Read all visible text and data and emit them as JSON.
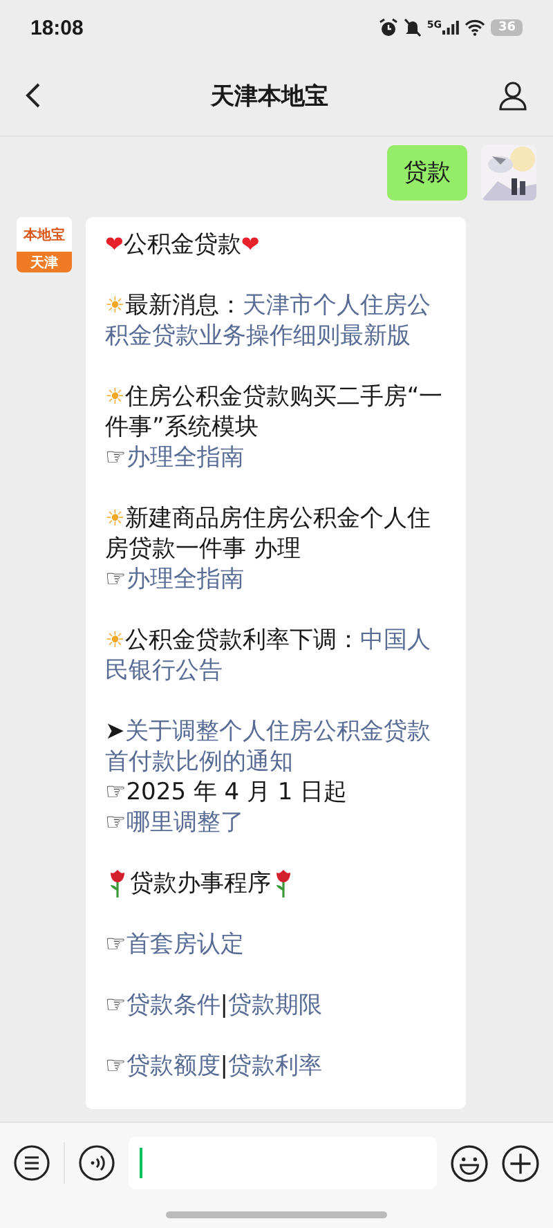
{
  "status_bar": {
    "time": "18:08",
    "network": "5G",
    "battery": "36"
  },
  "header": {
    "title": "天津本地宝"
  },
  "messages": [
    {
      "kind": "sent",
      "text": "贷款"
    },
    {
      "kind": "received",
      "avatar_top": "本地宝",
      "avatar_bottom": "天津",
      "paragraphs": [
        [
          [
            {
              "kind": "emoji",
              "text": "❤",
              "color": "#e8202a"
            },
            {
              "kind": "text",
              "text": "公积金贷款"
            },
            {
              "kind": "emoji",
              "text": "❤",
              "color": "#e8202a"
            }
          ]
        ],
        [
          [
            {
              "kind": "emoji",
              "text": "☀",
              "color": "#f5a623"
            },
            {
              "kind": "text",
              "text": "最新消息："
            },
            {
              "kind": "link",
              "text": "天津市个人住房公"
            }
          ],
          [
            {
              "kind": "link",
              "text": "积金贷款业务操作细则最新版"
            }
          ]
        ],
        [
          [
            {
              "kind": "emoji",
              "text": "☀",
              "color": "#f5a623"
            },
            {
              "kind": "text",
              "text": "住房公积金贷款购买二手房“一"
            }
          ],
          [
            {
              "kind": "text",
              "text": "件事”系统模块"
            }
          ],
          [
            {
              "kind": "text",
              "text": "☞ "
            },
            {
              "kind": "link",
              "text": "办理全指南"
            }
          ]
        ],
        [
          [
            {
              "kind": "emoji",
              "text": "☀",
              "color": "#f5a623"
            },
            {
              "kind": "text",
              "text": "新建商品房住房公积金个人住"
            }
          ],
          [
            {
              "kind": "text",
              "text": "房贷款一件事 办理"
            }
          ],
          [
            {
              "kind": "text",
              "text": "☞ "
            },
            {
              "kind": "link",
              "text": "办理全指南"
            }
          ]
        ],
        [
          [
            {
              "kind": "emoji",
              "text": "☀",
              "color": "#f5a623"
            },
            {
              "kind": "text",
              "text": "公积金贷款利率下调："
            },
            {
              "kind": "link",
              "text": "中国人"
            }
          ],
          [
            {
              "kind": "link",
              "text": "民银行公告"
            }
          ]
        ],
        [
          [
            {
              "kind": "text",
              "text": "➤ "
            },
            {
              "kind": "link",
              "text": "关于调整个人住房公积金贷款"
            }
          ],
          [
            {
              "kind": "link",
              "text": "首付款比例的通知"
            }
          ],
          [
            {
              "kind": "text",
              "text": "☞2025 年 4 月 1 日起"
            }
          ],
          [
            {
              "kind": "text",
              "text": "☞ "
            },
            {
              "kind": "link",
              "text": "哪里调整了"
            }
          ]
        ],
        [
          [
            {
              "kind": "flower"
            },
            {
              "kind": "text",
              "text": " 贷款办事程序 "
            },
            {
              "kind": "flower"
            }
          ]
        ],
        [
          [
            {
              "kind": "text",
              "text": "☞ "
            },
            {
              "kind": "link",
              "text": "首套房认定"
            }
          ]
        ],
        [
          [
            {
              "kind": "text",
              "text": "☞ "
            },
            {
              "kind": "link",
              "text": "贷款条件"
            },
            {
              "kind": "text",
              "text": " | "
            },
            {
              "kind": "link",
              "text": "贷款期限"
            }
          ]
        ],
        [
          [
            {
              "kind": "text",
              "text": "☞ "
            },
            {
              "kind": "link",
              "text": "贷款额度"
            },
            {
              "kind": "text",
              "text": " | "
            },
            {
              "kind": "link",
              "text": "贷款利率"
            }
          ]
        ]
      ]
    }
  ]
}
